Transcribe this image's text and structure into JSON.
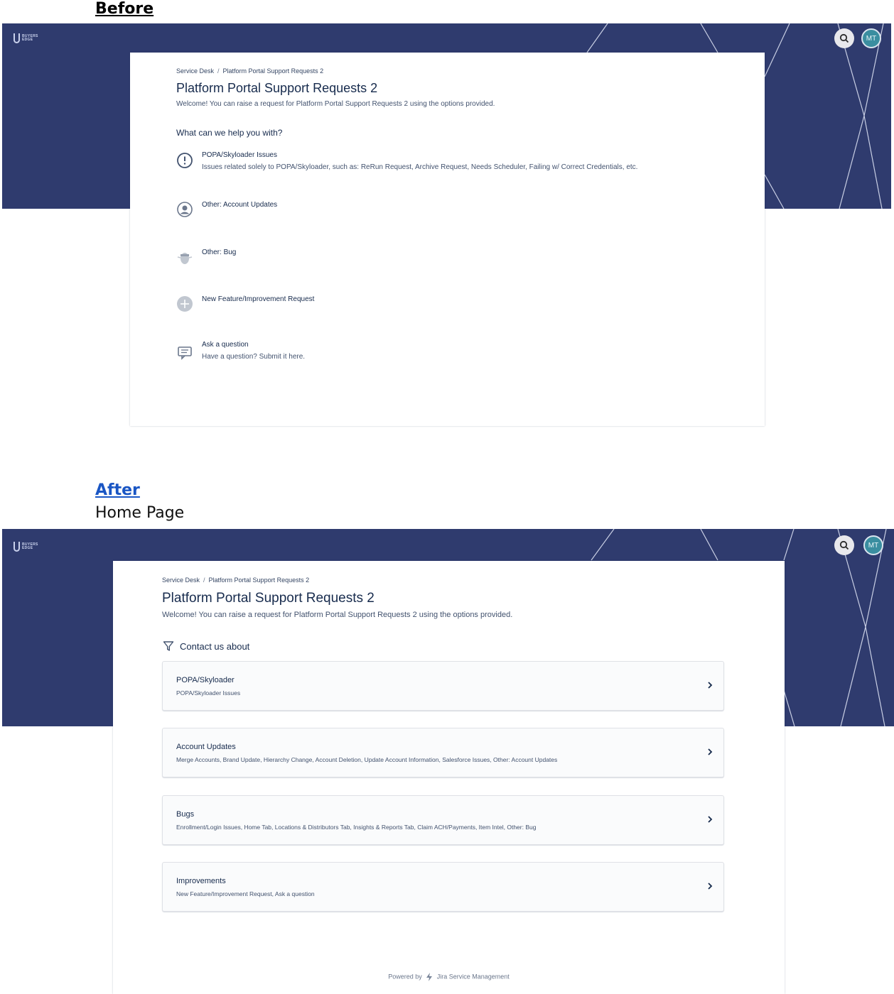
{
  "labels": {
    "before": "Before",
    "after": "After",
    "after_subtitle": "Home Page"
  },
  "header": {
    "avatar_initials": "MT",
    "brand_colour": "#2f3b6e",
    "avatar_colour": "#3a8ea0"
  },
  "portal": {
    "breadcrumb_root": "Service Desk",
    "breadcrumb_current": "Platform Portal Support Requests 2",
    "title": "Platform Portal Support Requests 2",
    "welcome": "Welcome! You can raise a request for Platform Portal Support Requests 2 using the options provided."
  },
  "before": {
    "help_heading": "What can we help you with?",
    "request_types": [
      {
        "name": "POPA/Skyloader Issues",
        "description": "Issues related solely to POPA/Skyloader, such as: ReRun Request, Archive Request, Needs Scheduler, Failing w/ Correct Credentials, etc.",
        "icon": "exclamation-circle-icon"
      },
      {
        "name": "Other: Account Updates",
        "description": "",
        "icon": "user-circle-icon"
      },
      {
        "name": "Other: Bug",
        "description": "",
        "icon": "bug-icon"
      },
      {
        "name": "New Feature/Improvement Request",
        "description": "",
        "icon": "plus-circle-icon"
      },
      {
        "name": "Ask a question",
        "description": "Have a question? Submit it here.",
        "icon": "message-icon"
      }
    ]
  },
  "after": {
    "contact_heading": "Contact us about",
    "groups": [
      {
        "title": "POPA/Skyloader",
        "subtitle": "POPA/Skyloader Issues"
      },
      {
        "title": "Account Updates",
        "subtitle": "Merge Accounts, Brand Update, Hierarchy Change, Account Deletion, Update Account Information, Salesforce Issues, Other: Account Updates"
      },
      {
        "title": "Bugs",
        "subtitle": "Enrollment/Login Issues, Home Tab, Locations & Distributors Tab, Insights & Reports Tab, Claim ACH/Payments, Item Intel, Other: Bug"
      },
      {
        "title": "Improvements",
        "subtitle": "New Feature/Improvement Request, Ask a question"
      }
    ],
    "powered_by": "Powered by",
    "powered_product": "Jira Service Management"
  }
}
